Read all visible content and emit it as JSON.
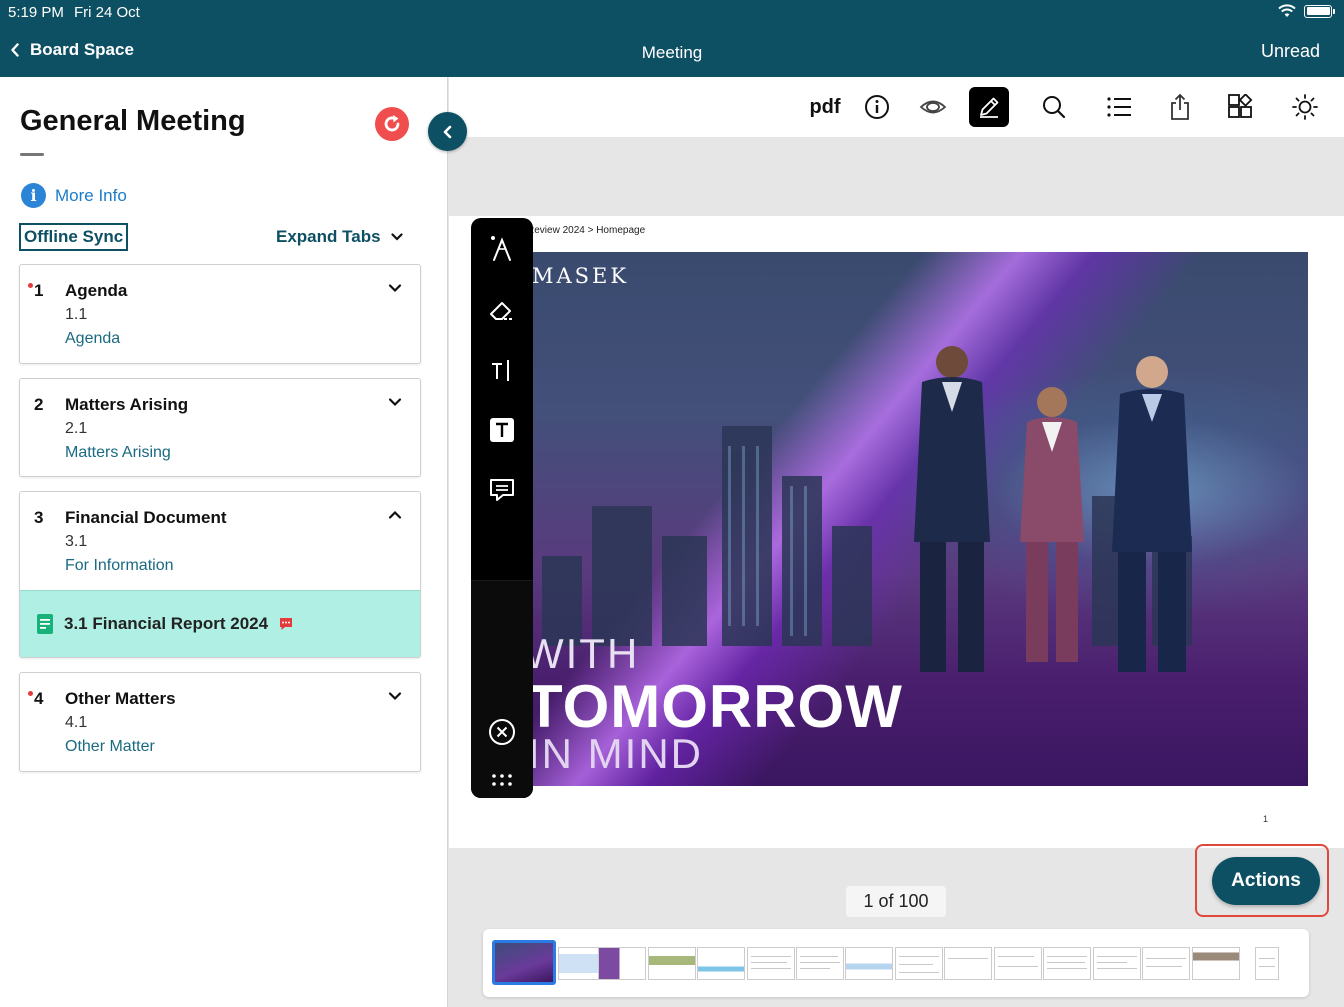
{
  "status_bar": {
    "time": "5:19 PM",
    "date": "Fri 24 Oct"
  },
  "nav": {
    "back_label": "Board Space",
    "title": "Meeting",
    "right_action": "Unread"
  },
  "sidebar": {
    "title": "General Meeting",
    "more_info": "More Info",
    "offline_sync": "Offline Sync",
    "expand_tabs": "Expand Tabs",
    "agenda": [
      {
        "number": "1",
        "title": "Agenda",
        "sub_number": "1.1",
        "link": "Agenda",
        "unread_dot": true,
        "expanded": false
      },
      {
        "number": "2",
        "title": "Matters Arising",
        "sub_number": "2.1",
        "link": "Matters Arising",
        "unread_dot": false,
        "expanded": false
      },
      {
        "number": "3",
        "title": "Financial Document",
        "sub_number": "3.1",
        "link": "For Information",
        "unread_dot": false,
        "expanded": true,
        "document": {
          "label": "3.1 Financial Report 2024",
          "icon": "document-icon",
          "badge_icon": "comment-icon"
        }
      },
      {
        "number": "4",
        "title": "Other Matters",
        "sub_number": "4.1",
        "link": "Other Matter",
        "unread_dot": true,
        "expanded": false
      }
    ]
  },
  "toolbar": {
    "pdf_label": "pdf",
    "icons": [
      "info-icon",
      "eye-icon",
      "pen-edit-icon",
      "search-icon",
      "list-icon",
      "share-icon",
      "apps-icon",
      "brightness-icon"
    ],
    "active": "pen-edit-icon"
  },
  "document": {
    "breadcrumb": "Review 2024 > Homepage",
    "brand": "MASEK",
    "hero_line1": "WITH",
    "hero_line2": "TOMORROW",
    "hero_line3": "IN MIND",
    "page_number": "1"
  },
  "annotation_tools": [
    "pen-tool-icon",
    "eraser-icon",
    "text-cursor-icon",
    "text-box-icon",
    "comment-icon",
    "close-circle-icon",
    "more-dots-icon"
  ],
  "page_counter": "1 of 100",
  "actions_label": "Actions",
  "colors": {
    "primary": "#0e5063",
    "link": "#1b7cc9",
    "selected_doc_bg": "#b0f0e4",
    "alert": "#e53b3b",
    "highlight_frame": "#e0483c"
  }
}
